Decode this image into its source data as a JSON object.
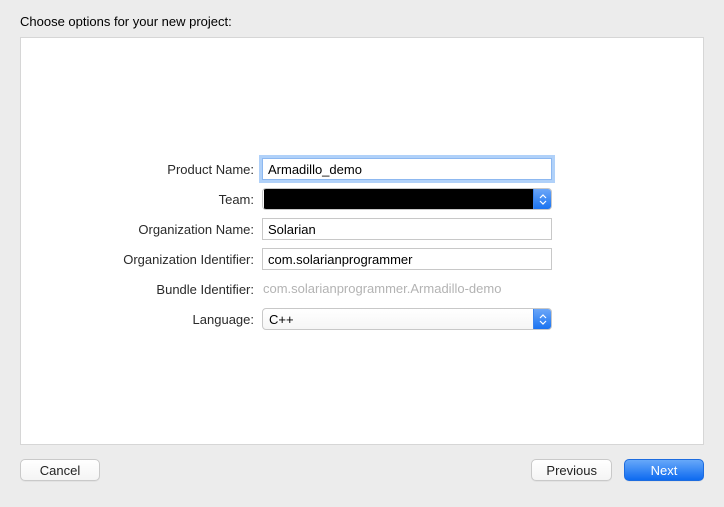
{
  "header": {
    "title": "Choose options for your new project:"
  },
  "form": {
    "product_name": {
      "label": "Product Name:",
      "value": "Armadillo_demo"
    },
    "team": {
      "label": "Team:",
      "value": ""
    },
    "org_name": {
      "label": "Organization Name:",
      "value": "Solarian"
    },
    "org_identifier": {
      "label": "Organization Identifier:",
      "value": "com.solarianprogrammer"
    },
    "bundle_identifier": {
      "label": "Bundle Identifier:",
      "value": "com.solarianprogrammer.Armadillo-demo"
    },
    "language": {
      "label": "Language:",
      "value": "C++"
    }
  },
  "footer": {
    "cancel": "Cancel",
    "previous": "Previous",
    "next": "Next"
  }
}
